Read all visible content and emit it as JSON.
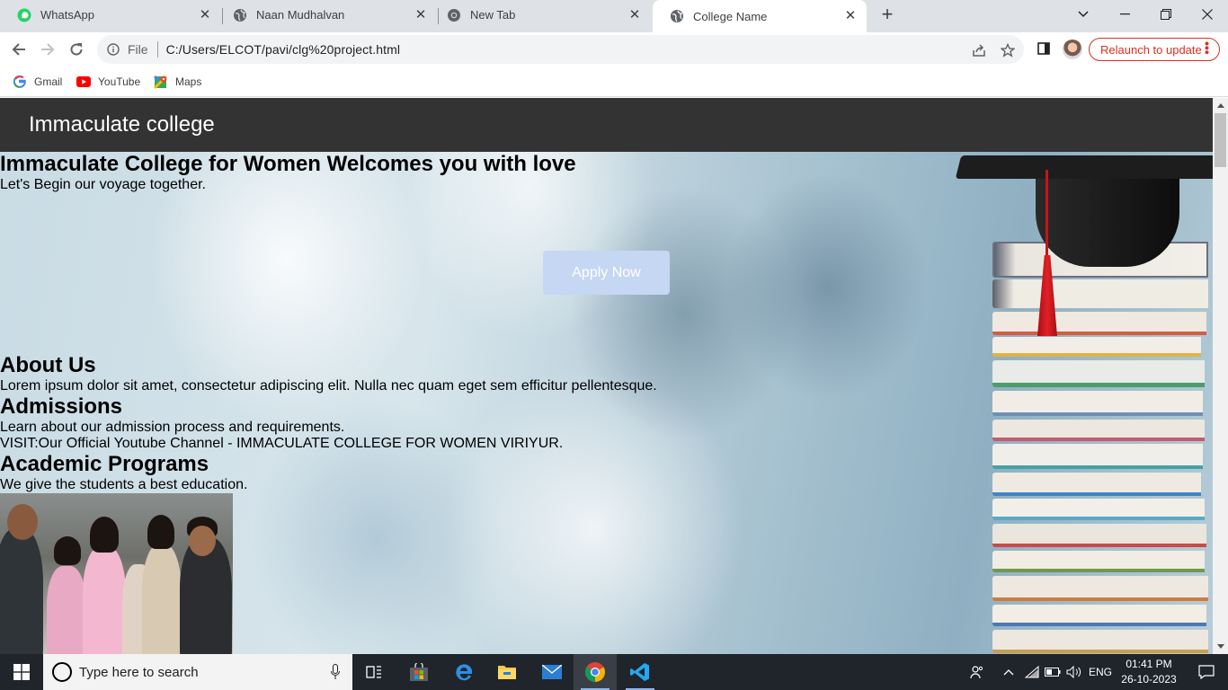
{
  "browser": {
    "tabs": [
      {
        "label": "WhatsApp",
        "icon": "whatsapp-icon",
        "active": false
      },
      {
        "label": "Naan Mudhalvan",
        "icon": "globe-icon",
        "active": false
      },
      {
        "label": "New Tab",
        "icon": "chrome-icon",
        "active": false
      },
      {
        "label": "College Name",
        "icon": "globe-icon",
        "active": true
      }
    ],
    "address": {
      "scheme": "File",
      "url": "C:/Users/ELCOT/pavi/clg%20project.html"
    },
    "relaunch_label": "Relaunch to update",
    "bookmarks": [
      {
        "label": "Gmail",
        "icon": "google-icon"
      },
      {
        "label": "YouTube",
        "icon": "youtube-icon"
      },
      {
        "label": "Maps",
        "icon": "maps-icon"
      }
    ],
    "accent_color": "#d93025"
  },
  "page": {
    "header_title": "Immaculate college",
    "hero_title": "Immaculate College for Women Welcomes you with love",
    "hero_subtitle": "Let's Begin our voyage together.",
    "apply_button": "Apply Now",
    "about_heading": "About Us",
    "about_text": "Lorem ipsum dolor sit amet, consectetur adipiscing elit. Nulla nec quam eget sem efficitur pellentesque.",
    "admissions_heading": "Admissions",
    "admissions_text": "Learn about our admission process and requirements.",
    "admissions_visit": "VISIT:Our Official Youtube Channel - IMMACULATE COLLEGE FOR WOMEN VIRIYUR.",
    "programs_heading": "Academic Programs",
    "programs_text": "We give the students a best education.",
    "header_bg": "#333333",
    "button_bg": "#c5d7f2"
  },
  "taskbar": {
    "search_placeholder": "Type here to search",
    "language": "ENG",
    "time": "01:41 PM",
    "date": "26-10-2023",
    "apps": [
      "task-view-icon",
      "store-icon",
      "edge-icon",
      "file-explorer-icon",
      "mail-icon",
      "chrome-icon",
      "vscode-icon"
    ]
  }
}
